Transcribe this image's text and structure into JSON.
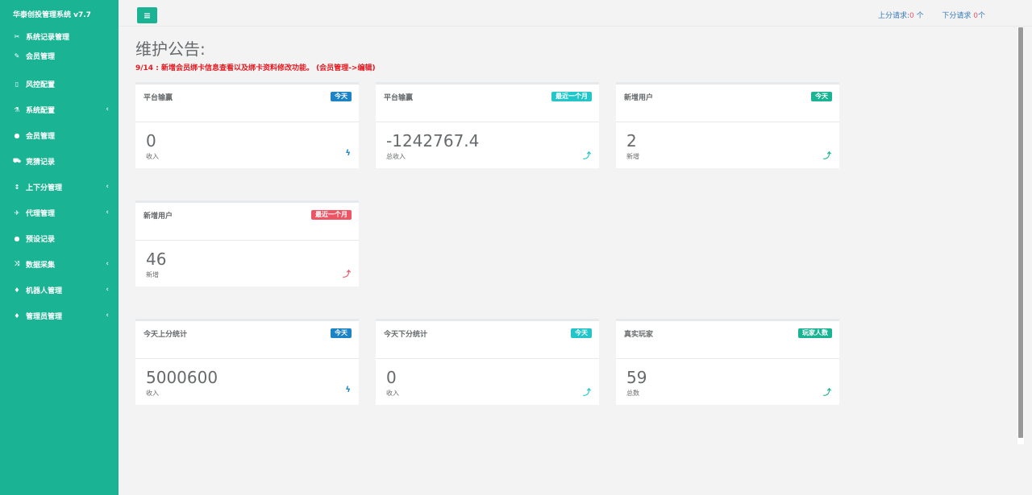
{
  "sidebar": {
    "brand": "华泰创投管理系统 v7.7",
    "items": [
      {
        "icon": "✂",
        "label": "系统记录管理",
        "caret": ""
      },
      {
        "icon": "✎",
        "label": "会员管理",
        "caret": ""
      },
      {
        "icon": "▯",
        "label": "风控配置",
        "caret": ""
      },
      {
        "icon": "⚗",
        "label": "系统配置",
        "caret": "‹"
      },
      {
        "icon": "●",
        "label": "会员管理",
        "caret": ""
      },
      {
        "icon": "⛟",
        "label": "竞猜记录",
        "caret": ""
      },
      {
        "icon": "↕",
        "label": "上下分管理",
        "caret": "‹"
      },
      {
        "icon": "✈",
        "label": "代理管理",
        "caret": "‹"
      },
      {
        "icon": "●",
        "label": "预设记录",
        "caret": ""
      },
      {
        "icon": "⤨",
        "label": "数据采集",
        "caret": "‹"
      },
      {
        "icon": "♦",
        "label": "机器人管理",
        "caret": "‹"
      },
      {
        "icon": "♦",
        "label": "管理员管理",
        "caret": "‹"
      }
    ]
  },
  "topbar": {
    "menu_icon": "≡",
    "up_label": "上分请求:",
    "up_count": "0",
    "up_unit": " 个",
    "down_label": "下分请求",
    "down_count": "0",
    "down_unit": "个"
  },
  "notice": {
    "title": "维护公告:",
    "text": "9/14 : 新增会员绑卡信息查看以及绑卡资料修改功能。   (会员管理->编辑)"
  },
  "cards": [
    {
      "title": "平台输赢",
      "badge": "今天",
      "value": "0",
      "sub": "收入",
      "icon": "ϟ"
    },
    {
      "title": "平台输赢",
      "badge": "最近一个月",
      "value": "-1242767.4",
      "sub": "总收入",
      "icon": "⤴"
    },
    {
      "title": "新增用户",
      "badge": "今天",
      "value": "2",
      "sub": "新增",
      "icon": "⤴"
    },
    {
      "title": "新增用户",
      "badge": "最近一个月",
      "value": "46",
      "sub": "新增",
      "icon": "⤴"
    },
    {
      "title": "今天上分统计",
      "badge": "今天",
      "value": "5000600",
      "sub": "收入",
      "icon": "ϟ"
    },
    {
      "title": "今天下分统计",
      "badge": "今天",
      "value": "0",
      "sub": "收入",
      "icon": "⤴"
    },
    {
      "title": "真实玩家",
      "badge": "玩家人数",
      "value": "59",
      "sub": "总数",
      "icon": "⤴"
    }
  ],
  "colors": {
    "sidebar": "#1ab394",
    "blue": "#1c84c6",
    "teal": "#23c6c8",
    "green": "#1ab394",
    "red": "#ed5565"
  }
}
